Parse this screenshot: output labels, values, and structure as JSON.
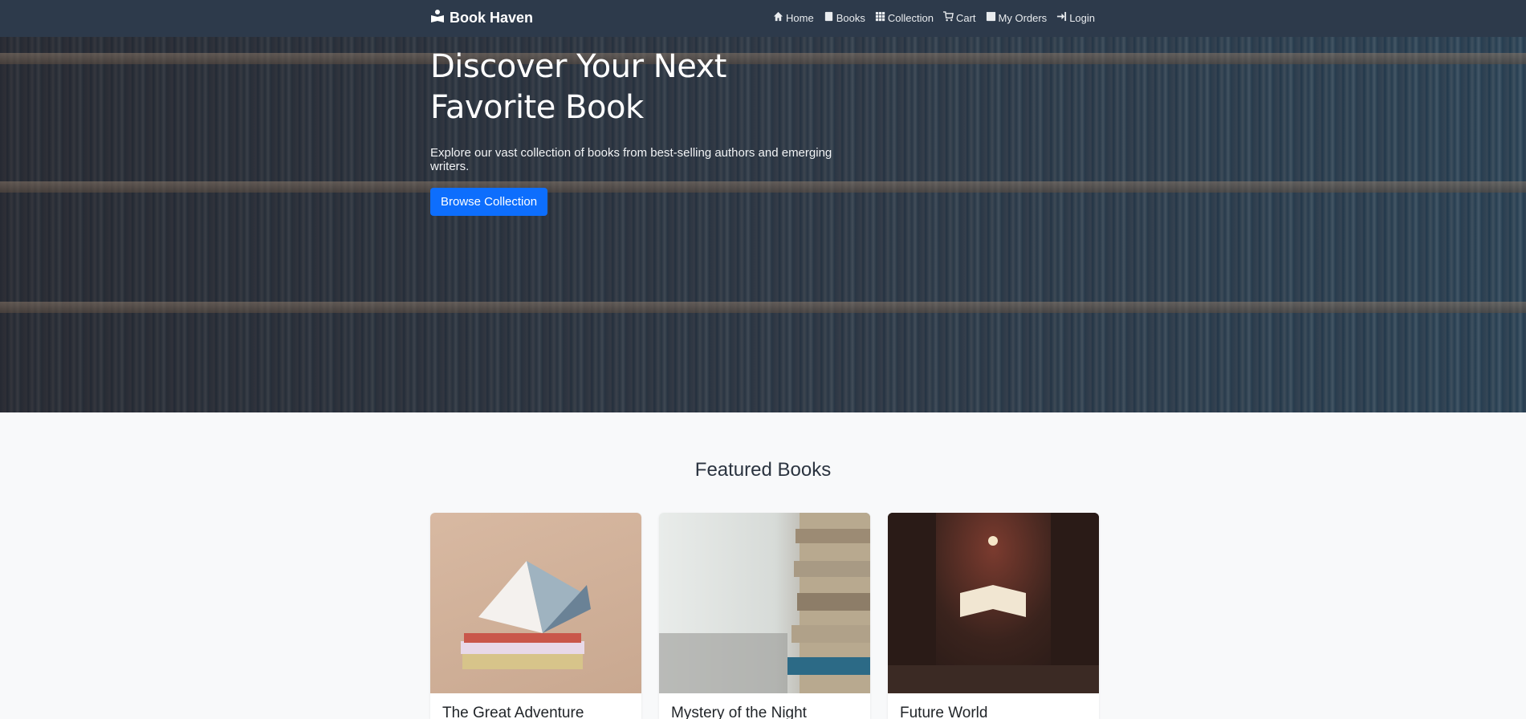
{
  "navbar": {
    "brand": "Book Haven",
    "items": [
      {
        "icon": "home-icon",
        "label": "Home"
      },
      {
        "icon": "book-icon",
        "label": "Books"
      },
      {
        "icon": "grid-icon",
        "label": "Collection"
      },
      {
        "icon": "cart-icon",
        "label": "Cart"
      },
      {
        "icon": "box-icon",
        "label": "My Orders"
      },
      {
        "icon": "login-icon",
        "label": "Login"
      }
    ]
  },
  "hero": {
    "title": "Discover Your Next Favorite Book",
    "subtitle": "Explore our vast collection of books from best-selling authors and emerging writers.",
    "button": "Browse Collection"
  },
  "featured": {
    "title": "Featured Books",
    "books": [
      {
        "title": "The Great Adventure"
      },
      {
        "title": "Mystery of the Night"
      },
      {
        "title": "Future World"
      }
    ]
  },
  "colors": {
    "navbar_bg": "#2d3a4b",
    "primary": "#0d6efd",
    "page_bg": "#f8f9fa"
  }
}
